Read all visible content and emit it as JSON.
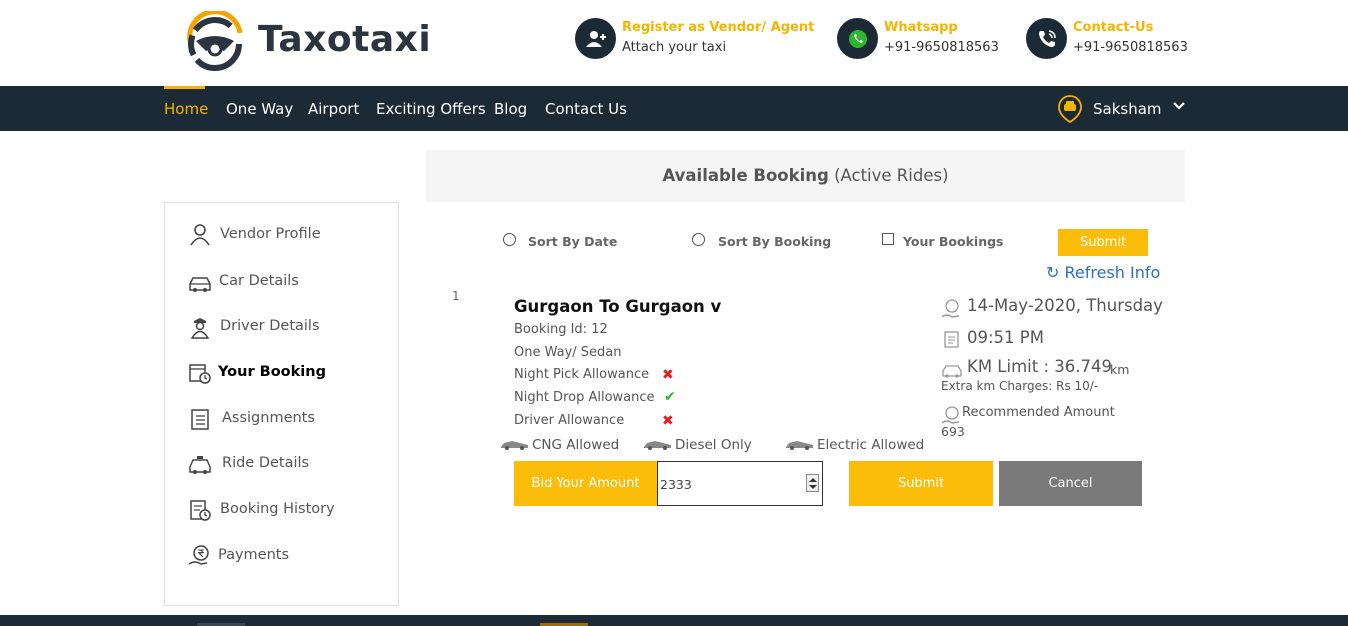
{
  "brand": {
    "name": "Taxotaxi",
    "accent": "#f5b400",
    "dark": "#1c2a36"
  },
  "header": {
    "vendor": {
      "title": "Register as Vendor/ Agent",
      "subtitle": "Attach your taxi",
      "icon": "user-plus-icon"
    },
    "whatsapp": {
      "title": "Whatsapp",
      "subtitle": "+91-9650818563",
      "icon": "whatsapp-icon"
    },
    "contact": {
      "title": "Contact-Us",
      "subtitle": "+91-9650818563",
      "icon": "phone-icon"
    }
  },
  "nav": {
    "items": [
      "Home",
      "One Way",
      "Airport",
      "Exciting Offers",
      "Blog",
      "Contact Us"
    ],
    "active": "Home",
    "user": "Saksham"
  },
  "sidebar": {
    "items": [
      {
        "label": "Vendor Profile",
        "icon": "user-icon"
      },
      {
        "label": "Car Details",
        "icon": "car-icon"
      },
      {
        "label": "Driver Details",
        "icon": "driver-icon"
      },
      {
        "label": "Your Booking",
        "icon": "calendar-clock-icon",
        "active": true
      },
      {
        "label": "Assignments",
        "icon": "checklist-icon"
      },
      {
        "label": "Ride Details",
        "icon": "taxi-icon"
      },
      {
        "label": "Booking History",
        "icon": "history-icon"
      },
      {
        "label": "Payments",
        "icon": "rupee-hand-icon"
      }
    ]
  },
  "main": {
    "title_bold": "Available Booking",
    "title_rest": "(Active Rides)",
    "sort": {
      "by_date": "Sort By Date",
      "by_booking": "Sort By Booking",
      "your_bookings": "Your Bookings",
      "submit": "Submit"
    },
    "refresh": "↻ Refresh Info",
    "booking": {
      "index": "1",
      "route": "Gurgaon To Gurgaon v",
      "booking_id": "Booking Id: 12",
      "trip_type": "One Way/ Sedan",
      "allowances": [
        {
          "label": "Night Pick Allowance",
          "mark": "✖",
          "allowed": false
        },
        {
          "label": "Night Drop Allowance",
          "mark": "✔",
          "allowed": true
        },
        {
          "label": "Driver Allowance",
          "mark": "✖",
          "allowed": false
        }
      ],
      "fuel": [
        "CNG Allowed",
        "Diesel Only",
        "Electric Allowed"
      ],
      "date": "14-May-2020, Thursday",
      "time": "09:51 PM",
      "km_limit_label": "KM Limit : 36.749",
      "km_unit": "km",
      "extra_charges": "Extra km Charges: Rs 10/-",
      "recommended_label": "Recommended Amount",
      "recommended_value": "693",
      "bid_label": "Bid Your Amount",
      "bid_value": "2333",
      "submit": "Submit",
      "cancel": "Cancel"
    }
  }
}
